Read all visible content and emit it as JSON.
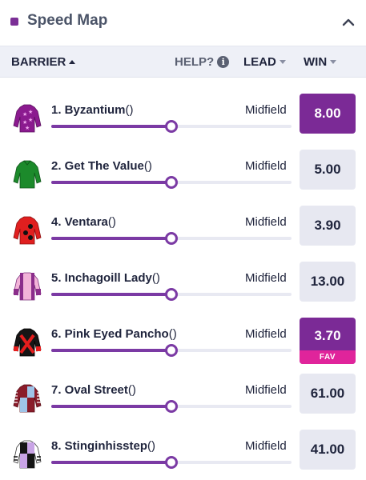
{
  "panel": {
    "title": "Speed Map",
    "accent_color": "#7b2f96",
    "collapse_icon": "chevron-up-icon"
  },
  "columns": {
    "barrier": "BARRIER",
    "help": "HELP?",
    "lead": "LEAD",
    "win": "WIN"
  },
  "runners": [
    {
      "name": "1. Byzantium",
      "jockey": "()",
      "position_label": "Midfield",
      "position_value_pct": 50,
      "odds": "8.00",
      "selected": true,
      "favourite": false,
      "silk": "purple-pink-stars"
    },
    {
      "name": "2. Get The Value",
      "jockey": "()",
      "position_label": "Midfield",
      "position_value_pct": 50,
      "odds": "5.00",
      "selected": false,
      "favourite": false,
      "silk": "green"
    },
    {
      "name": "4. Ventara",
      "jockey": "()",
      "position_label": "Midfield",
      "position_value_pct": 50,
      "odds": "3.90",
      "selected": false,
      "favourite": false,
      "silk": "red-black-spots"
    },
    {
      "name": "5. Inchagoill Lady",
      "jockey": "()",
      "position_label": "Midfield",
      "position_value_pct": 50,
      "odds": "13.00",
      "selected": false,
      "favourite": false,
      "silk": "purple-pink-stripes"
    },
    {
      "name": "6. Pink Eyed Pancho",
      "jockey": "()",
      "position_label": "Midfield",
      "position_value_pct": 50,
      "odds": "3.70",
      "selected": false,
      "favourite": true,
      "fav_label": "FAV",
      "silk": "black-red-cross"
    },
    {
      "name": "7. Oval Street",
      "jockey": "()",
      "position_label": "Midfield",
      "position_value_pct": 50,
      "odds": "61.00",
      "selected": false,
      "favourite": false,
      "silk": "maroon-blue-quarters"
    },
    {
      "name": "8. Stinginhisstep",
      "jockey": "()",
      "position_label": "Midfield",
      "position_value_pct": 50,
      "odds": "41.00",
      "selected": false,
      "favourite": false,
      "silk": "black-lilac-quarters"
    }
  ]
}
